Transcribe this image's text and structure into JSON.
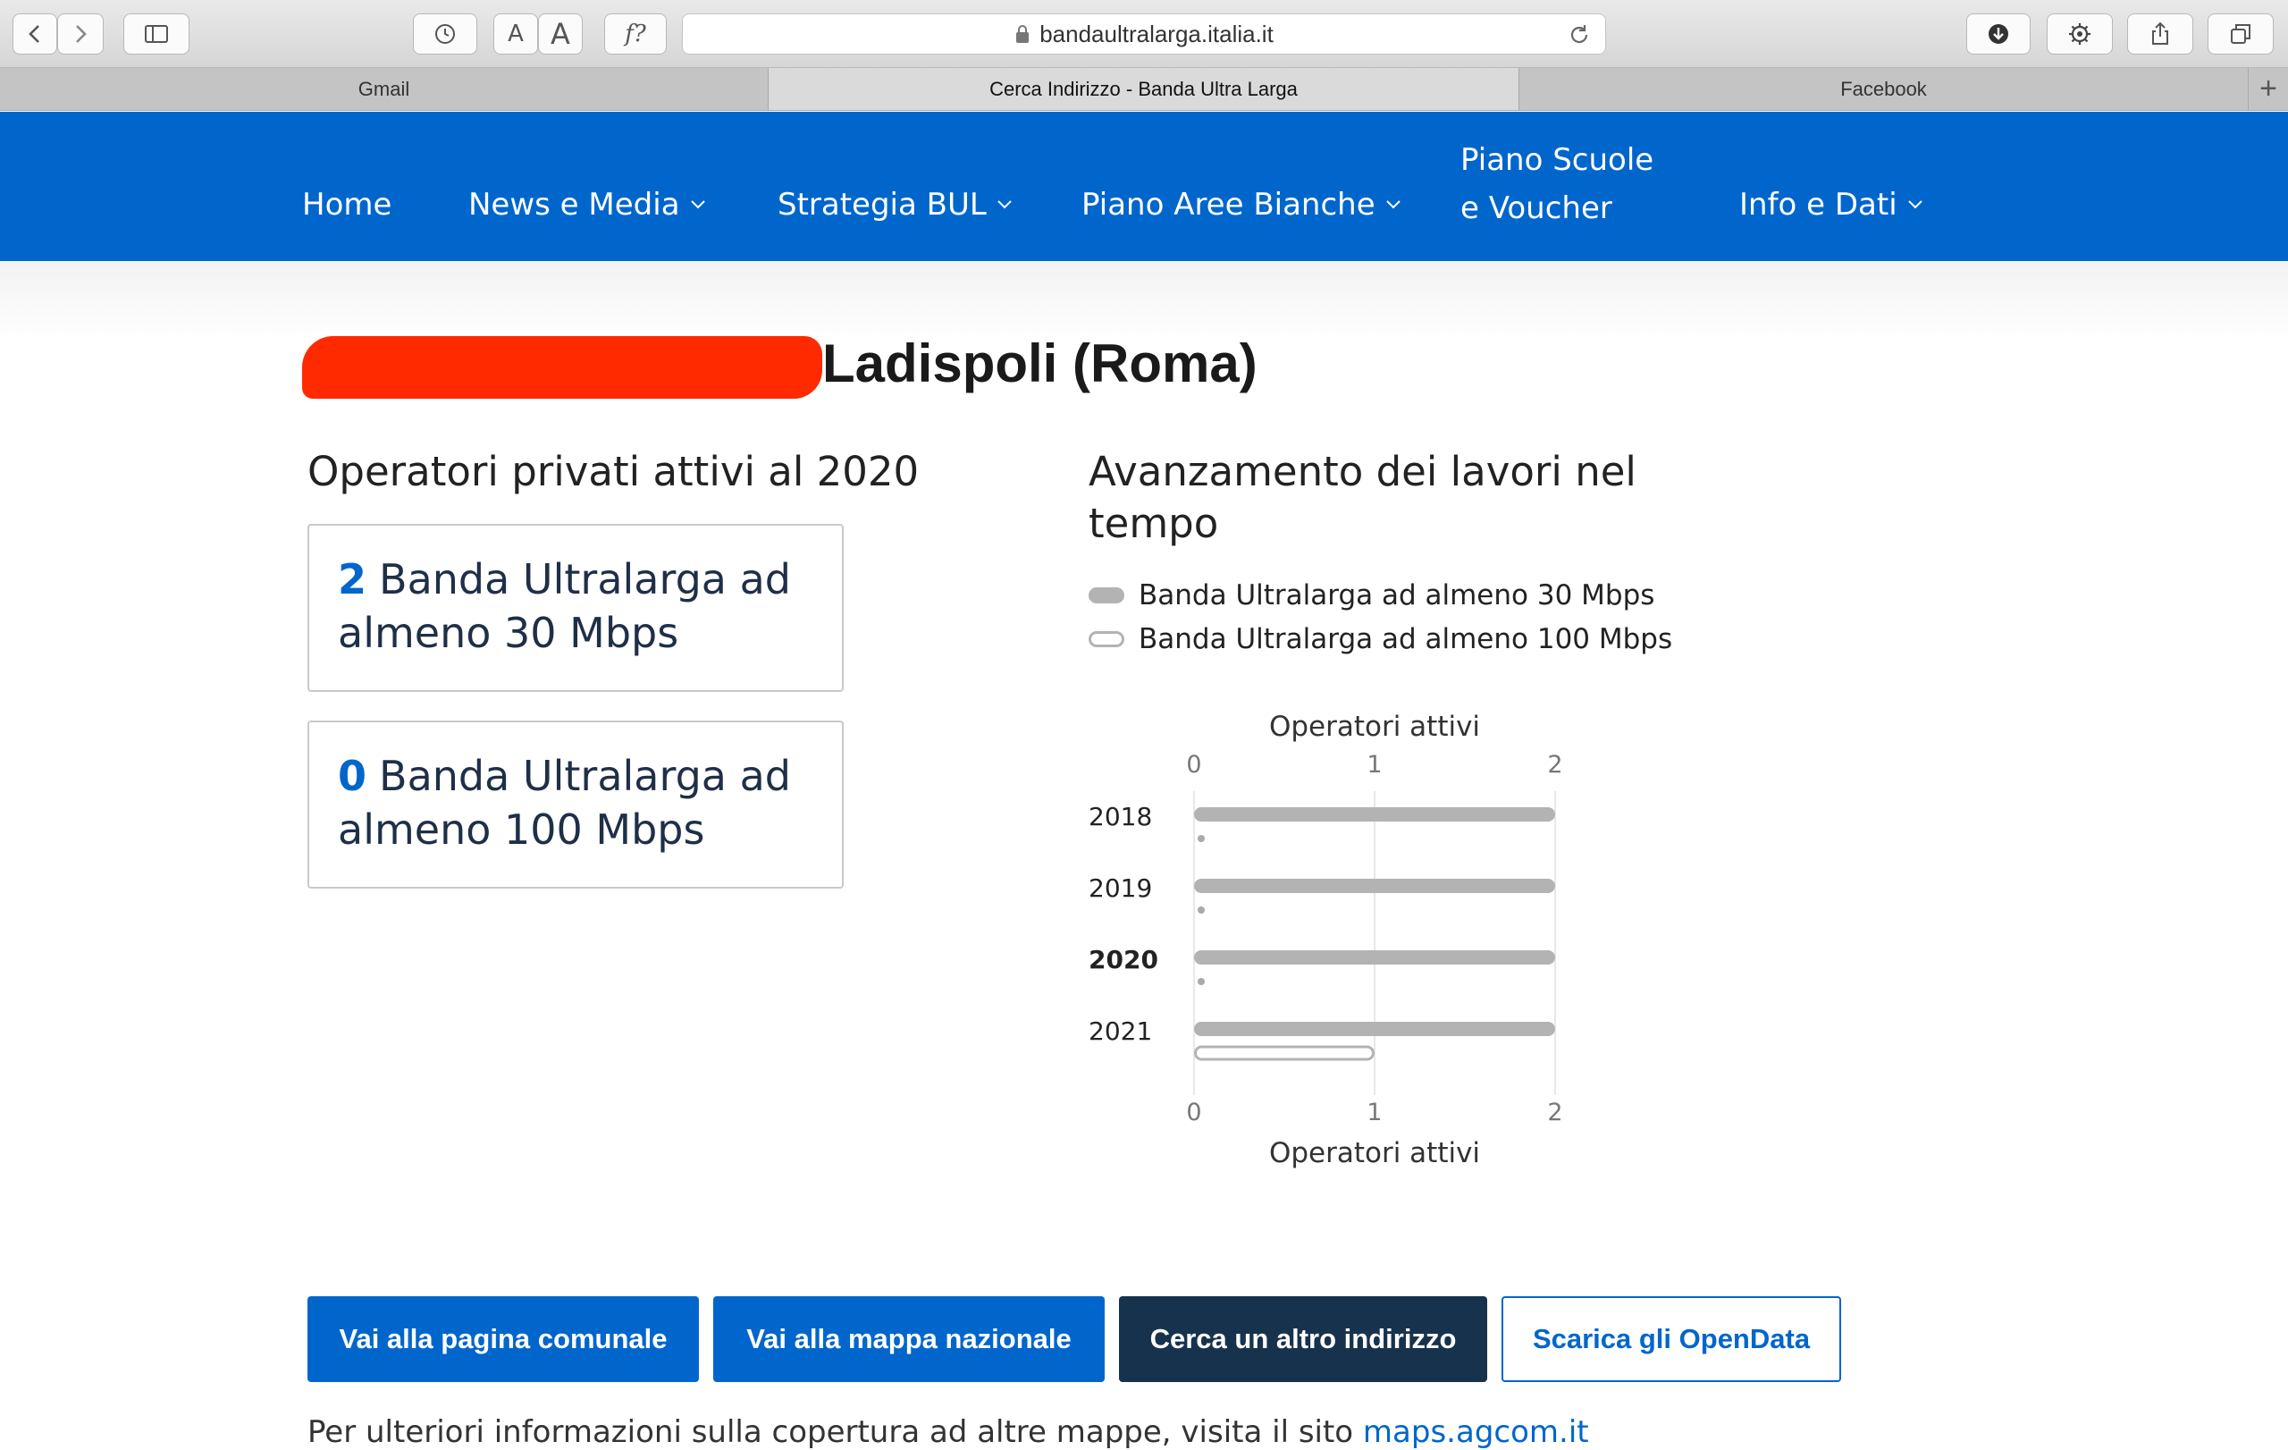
{
  "browser": {
    "url": "bandaultralarga.italia.it",
    "reader_text_small": "A",
    "reader_text_large": "A",
    "formula_label": "f?",
    "tabs": [
      {
        "label": "Gmail"
      },
      {
        "label": "Cerca Indirizzo - Banda Ultra Larga"
      },
      {
        "label": "Facebook"
      }
    ],
    "new_tab_label": "+"
  },
  "nav": {
    "items": [
      {
        "label": "Home"
      },
      {
        "label": "News e Media"
      },
      {
        "label": "Strategia BUL"
      },
      {
        "label": "Piano Aree Bianche"
      },
      {
        "label": "Piano Scuole"
      },
      {
        "label": "e Voucher"
      },
      {
        "label": "Info e Dati"
      }
    ]
  },
  "page": {
    "place": "Ladispoli (Roma)",
    "operators_heading": "Operatori privati attivi al 2020",
    "op_boxes": [
      {
        "count": "2",
        "line1": "Banda Ultralarga ad",
        "line2": "almeno 30 Mbps"
      },
      {
        "count": "0",
        "line1": "Banda Ultralarga ad",
        "line2": "almeno 100 Mbps"
      }
    ],
    "progress_heading_1": "Avanzamento dei lavori nel",
    "progress_heading_2": "tempo",
    "legend": [
      {
        "label": "Banda Ultralarga ad almeno 30 Mbps"
      },
      {
        "label": "Banda Ultralarga ad almeno 100 Mbps"
      }
    ]
  },
  "chart_data": {
    "type": "bar",
    "orientation": "horizontal",
    "title": "",
    "xlabel": "Operatori attivi",
    "ylabel": "",
    "xlim": [
      0,
      2
    ],
    "x_ticks": [
      "0",
      "1",
      "2"
    ],
    "categories": [
      "2018",
      "2019",
      "2020",
      "2021"
    ],
    "highlighted_category": "2020",
    "series": [
      {
        "name": "Banda Ultralarga ad almeno 30 Mbps",
        "values": [
          2,
          2,
          2,
          2
        ],
        "style": "filled",
        "color": "#b3b3b3"
      },
      {
        "name": "Banda Ultralarga ad almeno 100 Mbps",
        "values": [
          0,
          0,
          0,
          1
        ],
        "style": "outline",
        "color": "#b3b3b3"
      }
    ],
    "grid": true,
    "legend": "top"
  },
  "buttons": {
    "comunale": "Vai alla pagina comunale",
    "mappa": "Vai alla mappa nazionale",
    "cerca": "Cerca un altro indirizzo",
    "opendata": "Scarica gli OpenData"
  },
  "footer": {
    "text": "Per ulteriori informazioni sulla copertura ad altre mappe, visita il sito ",
    "link": "maps.agcom.it"
  },
  "colors": {
    "brand": "#0066cc",
    "dark_button": "#17324d",
    "redaction": "#ff2a00",
    "bar": "#b3b3b3"
  }
}
